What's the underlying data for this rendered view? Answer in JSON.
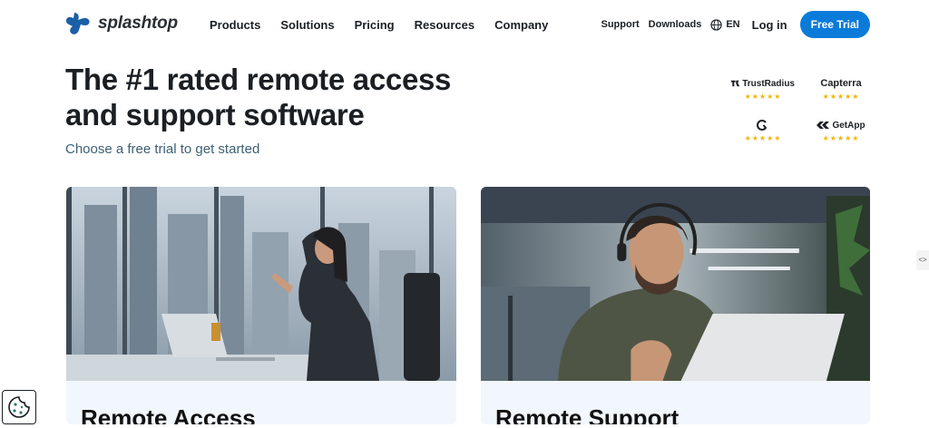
{
  "brand": {
    "name": "splashtop"
  },
  "nav": {
    "items": [
      "Products",
      "Solutions",
      "Pricing",
      "Resources",
      "Company"
    ],
    "support": "Support",
    "downloads": "Downloads",
    "language": "EN",
    "login": "Log in",
    "cta": "Free Trial"
  },
  "hero": {
    "title_line1": "The #1 rated remote access",
    "title_line2": "and support software",
    "subtitle": "Choose a free trial to get started"
  },
  "ratings": [
    {
      "brand": "TrustRadius",
      "stars": "★★★★★"
    },
    {
      "brand": "Capterra",
      "stars": "★★★★★"
    },
    {
      "brand": "",
      "stars": "★★★★★"
    },
    {
      "brand": "GetApp",
      "stars": "★★★★★"
    }
  ],
  "cards": [
    {
      "title": "Remote Access"
    },
    {
      "title": "Remote Support"
    }
  ],
  "side_tab": {
    "label": "<>"
  },
  "colors": {
    "accent": "#0a7bd9",
    "subtitle": "#3d5f74",
    "stars": "#f4b400",
    "card_bg": "#f1f7fc"
  }
}
